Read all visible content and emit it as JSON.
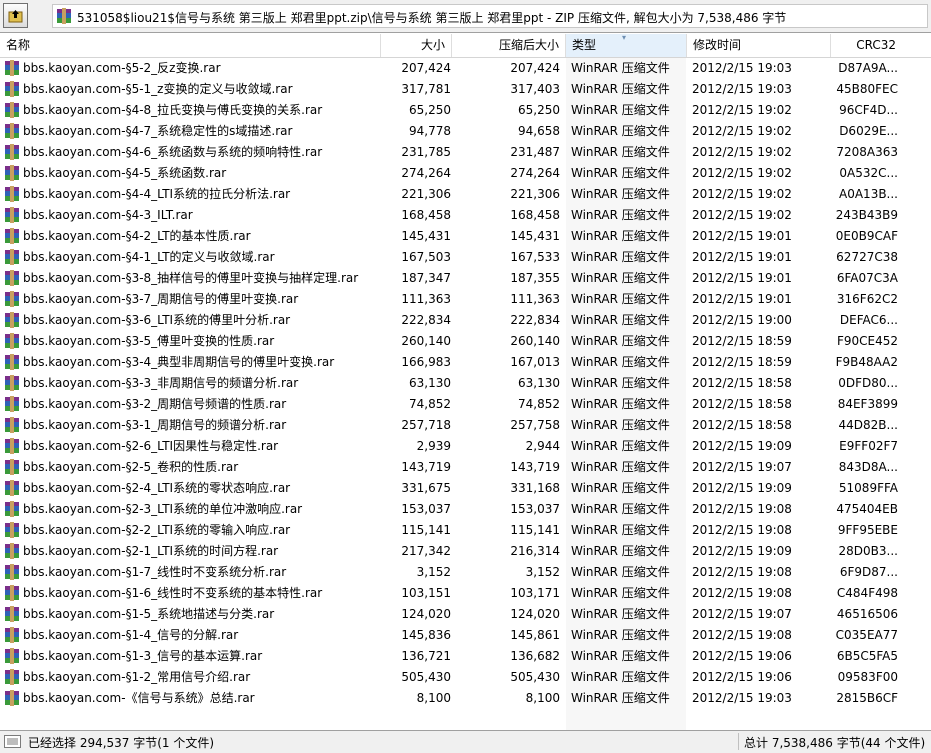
{
  "path": "531058$liou21$信号与系统 第三版上 郑君里ppt.zip\\信号与系统 第三版上 郑君里ppt - ZIP 压缩文件, 解包大小为 7,538,486 字节",
  "columns": {
    "name": "名称",
    "size": "大小",
    "packed": "压缩后大小",
    "type": "类型",
    "modified": "修改时间",
    "crc": "CRC32"
  },
  "files": [
    {
      "name": "bbs.kaoyan.com-§5-2_反z变换.rar",
      "size": "207,424",
      "packed": "207,424",
      "type": "WinRAR 压缩文件",
      "modified": "2012/2/15 19:03",
      "crc": "D87A9A..."
    },
    {
      "name": "bbs.kaoyan.com-§5-1_z变换的定义与收敛域.rar",
      "size": "317,781",
      "packed": "317,403",
      "type": "WinRAR 压缩文件",
      "modified": "2012/2/15 19:03",
      "crc": "45B80FEC"
    },
    {
      "name": "bbs.kaoyan.com-§4-8_拉氏变换与傅氏变换的关系.rar",
      "size": "65,250",
      "packed": "65,250",
      "type": "WinRAR 压缩文件",
      "modified": "2012/2/15 19:02",
      "crc": "96CF4D..."
    },
    {
      "name": "bbs.kaoyan.com-§4-7_系统稳定性的s域描述.rar",
      "size": "94,778",
      "packed": "94,658",
      "type": "WinRAR 压缩文件",
      "modified": "2012/2/15 19:02",
      "crc": "D6029E..."
    },
    {
      "name": "bbs.kaoyan.com-§4-6_系统函数与系统的频响特性.rar",
      "size": "231,785",
      "packed": "231,487",
      "type": "WinRAR 压缩文件",
      "modified": "2012/2/15 19:02",
      "crc": "7208A363"
    },
    {
      "name": "bbs.kaoyan.com-§4-5_系统函数.rar",
      "size": "274,264",
      "packed": "274,264",
      "type": "WinRAR 压缩文件",
      "modified": "2012/2/15 19:02",
      "crc": "0A532C..."
    },
    {
      "name": "bbs.kaoyan.com-§4-4_LTI系统的拉氏分析法.rar",
      "size": "221,306",
      "packed": "221,306",
      "type": "WinRAR 压缩文件",
      "modified": "2012/2/15 19:02",
      "crc": "A0A13B..."
    },
    {
      "name": "bbs.kaoyan.com-§4-3_ILT.rar",
      "size": "168,458",
      "packed": "168,458",
      "type": "WinRAR 压缩文件",
      "modified": "2012/2/15 19:02",
      "crc": "243B43B9"
    },
    {
      "name": "bbs.kaoyan.com-§4-2_LT的基本性质.rar",
      "size": "145,431",
      "packed": "145,431",
      "type": "WinRAR 压缩文件",
      "modified": "2012/2/15 19:01",
      "crc": "0E0B9CAF"
    },
    {
      "name": "bbs.kaoyan.com-§4-1_LT的定义与收敛域.rar",
      "size": "167,503",
      "packed": "167,533",
      "type": "WinRAR 压缩文件",
      "modified": "2012/2/15 19:01",
      "crc": "62727C38"
    },
    {
      "name": "bbs.kaoyan.com-§3-8_抽样信号的傅里叶变换与抽样定理.rar",
      "size": "187,347",
      "packed": "187,355",
      "type": "WinRAR 压缩文件",
      "modified": "2012/2/15 19:01",
      "crc": "6FA07C3A"
    },
    {
      "name": "bbs.kaoyan.com-§3-7_周期信号的傅里叶变换.rar",
      "size": "111,363",
      "packed": "111,363",
      "type": "WinRAR 压缩文件",
      "modified": "2012/2/15 19:01",
      "crc": "316F62C2"
    },
    {
      "name": "bbs.kaoyan.com-§3-6_LTI系统的傅里叶分析.rar",
      "size": "222,834",
      "packed": "222,834",
      "type": "WinRAR 压缩文件",
      "modified": "2012/2/15 19:00",
      "crc": "DEFAC6..."
    },
    {
      "name": "bbs.kaoyan.com-§3-5_傅里叶变换的性质.rar",
      "size": "260,140",
      "packed": "260,140",
      "type": "WinRAR 压缩文件",
      "modified": "2012/2/15 18:59",
      "crc": "F90CE452"
    },
    {
      "name": "bbs.kaoyan.com-§3-4_典型非周期信号的傅里叶变换.rar",
      "size": "166,983",
      "packed": "167,013",
      "type": "WinRAR 压缩文件",
      "modified": "2012/2/15 18:59",
      "crc": "F9B48AA2"
    },
    {
      "name": "bbs.kaoyan.com-§3-3_非周期信号的频谱分析.rar",
      "size": "63,130",
      "packed": "63,130",
      "type": "WinRAR 压缩文件",
      "modified": "2012/2/15 18:58",
      "crc": "0DFD80..."
    },
    {
      "name": "bbs.kaoyan.com-§3-2_周期信号频谱的性质.rar",
      "size": "74,852",
      "packed": "74,852",
      "type": "WinRAR 压缩文件",
      "modified": "2012/2/15 18:58",
      "crc": "84EF3899"
    },
    {
      "name": "bbs.kaoyan.com-§3-1_周期信号的频谱分析.rar",
      "size": "257,718",
      "packed": "257,758",
      "type": "WinRAR 压缩文件",
      "modified": "2012/2/15 18:58",
      "crc": "44D82B..."
    },
    {
      "name": "bbs.kaoyan.com-§2-6_LTI因果性与稳定性.rar",
      "size": "2,939",
      "packed": "2,944",
      "type": "WinRAR 压缩文件",
      "modified": "2012/2/15 19:09",
      "crc": "E9FF02F7"
    },
    {
      "name": "bbs.kaoyan.com-§2-5_卷积的性质.rar",
      "size": "143,719",
      "packed": "143,719",
      "type": "WinRAR 压缩文件",
      "modified": "2012/2/15 19:07",
      "crc": "843D8A..."
    },
    {
      "name": "bbs.kaoyan.com-§2-4_LTI系统的零状态响应.rar",
      "size": "331,675",
      "packed": "331,168",
      "type": "WinRAR 压缩文件",
      "modified": "2012/2/15 19:09",
      "crc": "51089FFA"
    },
    {
      "name": "bbs.kaoyan.com-§2-3_LTI系统的单位冲激响应.rar",
      "size": "153,037",
      "packed": "153,037",
      "type": "WinRAR 压缩文件",
      "modified": "2012/2/15 19:08",
      "crc": "475404EB"
    },
    {
      "name": "bbs.kaoyan.com-§2-2_LTI系统的零输入响应.rar",
      "size": "115,141",
      "packed": "115,141",
      "type": "WinRAR 压缩文件",
      "modified": "2012/2/15 19:08",
      "crc": "9FF95EBE"
    },
    {
      "name": "bbs.kaoyan.com-§2-1_LTI系统的时间方程.rar",
      "size": "217,342",
      "packed": "216,314",
      "type": "WinRAR 压缩文件",
      "modified": "2012/2/15 19:09",
      "crc": "28D0B3..."
    },
    {
      "name": "bbs.kaoyan.com-§1-7_线性时不变系统分析.rar",
      "size": "3,152",
      "packed": "3,152",
      "type": "WinRAR 压缩文件",
      "modified": "2012/2/15 19:08",
      "crc": "6F9D87..."
    },
    {
      "name": "bbs.kaoyan.com-§1-6_线性时不变系统的基本特性.rar",
      "size": "103,151",
      "packed": "103,171",
      "type": "WinRAR 压缩文件",
      "modified": "2012/2/15 19:08",
      "crc": "C484F498"
    },
    {
      "name": "bbs.kaoyan.com-§1-5_系统地描述与分类.rar",
      "size": "124,020",
      "packed": "124,020",
      "type": "WinRAR 压缩文件",
      "modified": "2012/2/15 19:07",
      "crc": "46516506"
    },
    {
      "name": "bbs.kaoyan.com-§1-4_信号的分解.rar",
      "size": "145,836",
      "packed": "145,861",
      "type": "WinRAR 压缩文件",
      "modified": "2012/2/15 19:08",
      "crc": "C035EA77"
    },
    {
      "name": "bbs.kaoyan.com-§1-3_信号的基本运算.rar",
      "size": "136,721",
      "packed": "136,682",
      "type": "WinRAR 压缩文件",
      "modified": "2012/2/15 19:06",
      "crc": "6B5C5FA5"
    },
    {
      "name": "bbs.kaoyan.com-§1-2_常用信号介绍.rar",
      "size": "505,430",
      "packed": "505,430",
      "type": "WinRAR 压缩文件",
      "modified": "2012/2/15 19:06",
      "crc": "09583F00"
    },
    {
      "name": "bbs.kaoyan.com-《信号与系统》总结.rar",
      "size": "8,100",
      "packed": "8,100",
      "type": "WinRAR 压缩文件",
      "modified": "2012/2/15 19:03",
      "crc": "2815B6CF"
    }
  ],
  "status": {
    "selected": "已经选择 294,537 字节(1 个文件)",
    "total": "总计 7,538,486 字节(44 个文件)"
  },
  "icons": {
    "up": "up-folder-icon",
    "archive": "rar-archive-icon"
  }
}
